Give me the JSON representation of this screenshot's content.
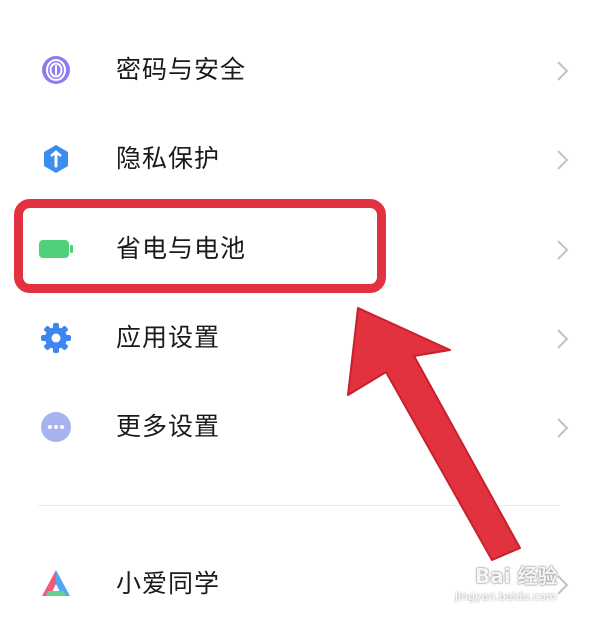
{
  "settings": {
    "items": [
      {
        "label": "密码与安全",
        "icon": "fingerprint-icon",
        "color": "#8b7cf0"
      },
      {
        "label": "隐私保护",
        "icon": "privacy-shield-icon",
        "color": "#3b8ef0"
      },
      {
        "label": "省电与电池",
        "icon": "battery-icon",
        "color": "#4ed17a"
      },
      {
        "label": "应用设置",
        "icon": "gear-icon",
        "color": "#3d86f2"
      },
      {
        "label": "更多设置",
        "icon": "more-dots-icon",
        "color": "#a7b2ee"
      },
      {
        "label": "小爱同学",
        "icon": "xiaoai-icon",
        "color": "#4fa8f5"
      }
    ]
  },
  "annotation": {
    "highlight_color": "#e2323f",
    "highlighted_item": "省电与电池"
  },
  "watermark": {
    "brand": "Bai 经验",
    "url": "jingyan.baidu.com"
  }
}
